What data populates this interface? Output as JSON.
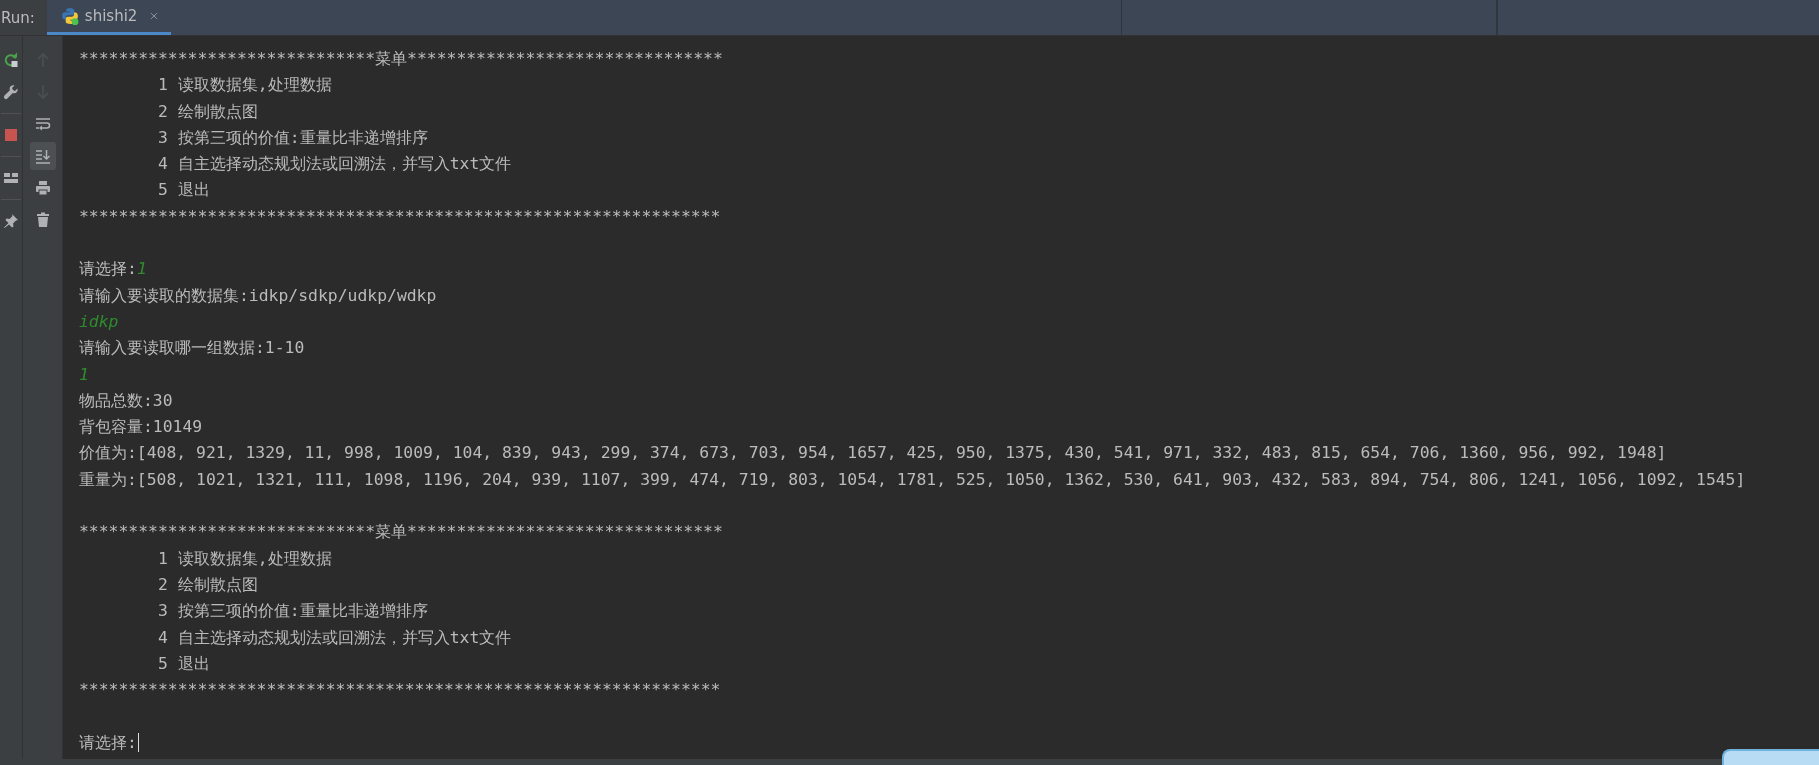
{
  "run_bar": {
    "label": "Run:",
    "tabs": [
      {
        "label": "shishi2",
        "selected": true,
        "closable": true
      }
    ]
  },
  "left_toolbar": [
    {
      "kind": "rerun",
      "disabled": false
    },
    {
      "kind": "wrench",
      "disabled": false
    },
    {
      "kind": "stop",
      "disabled": false
    },
    {
      "kind": "layout",
      "disabled": false
    },
    {
      "kind": "pin",
      "disabled": false
    }
  ],
  "console_toolbar": [
    {
      "kind": "up",
      "disabled": true,
      "selected": false
    },
    {
      "kind": "down",
      "disabled": true,
      "selected": false
    },
    {
      "kind": "wrap",
      "disabled": false,
      "selected": false
    },
    {
      "kind": "scroll-end",
      "disabled": false,
      "selected": true
    },
    {
      "kind": "print",
      "disabled": false,
      "selected": false
    },
    {
      "kind": "trash",
      "disabled": false,
      "selected": false
    }
  ],
  "console_lines": [
    {
      "kind": "text",
      "segments": [
        {
          "kind": "output",
          "text": "******************************菜单********************************"
        }
      ]
    },
    {
      "kind": "menu",
      "segments": [
        {
          "kind": "output",
          "text": "1 读取数据集,处理数据"
        }
      ]
    },
    {
      "kind": "menu",
      "segments": [
        {
          "kind": "output",
          "text": "2 绘制散点图"
        }
      ]
    },
    {
      "kind": "menu",
      "segments": [
        {
          "kind": "output",
          "text": "3 按第三项的价值:重量比非递增排序"
        }
      ]
    },
    {
      "kind": "menu",
      "segments": [
        {
          "kind": "output",
          "text": "4 自主选择动态规划法或回溯法，并写入txt文件"
        }
      ]
    },
    {
      "kind": "menu",
      "segments": [
        {
          "kind": "output",
          "text": "5 退出"
        }
      ]
    },
    {
      "kind": "text",
      "segments": [
        {
          "kind": "output",
          "text": "*****************************************************************"
        }
      ]
    },
    {
      "kind": "blank"
    },
    {
      "kind": "text",
      "segments": [
        {
          "kind": "output",
          "text": "请选择:"
        },
        {
          "kind": "input",
          "text": "1"
        }
      ]
    },
    {
      "kind": "text",
      "segments": [
        {
          "kind": "output",
          "text": "请输入要读取的数据集:idkp/sdkp/udkp/wdkp"
        }
      ]
    },
    {
      "kind": "text",
      "segments": [
        {
          "kind": "input",
          "text": "idkp"
        }
      ]
    },
    {
      "kind": "text",
      "segments": [
        {
          "kind": "output",
          "text": "请输入要读取哪一组数据:1-10"
        }
      ]
    },
    {
      "kind": "text",
      "segments": [
        {
          "kind": "input",
          "text": "1"
        }
      ]
    },
    {
      "kind": "text",
      "segments": [
        {
          "kind": "output",
          "text": "物品总数:30"
        }
      ]
    },
    {
      "kind": "text",
      "segments": [
        {
          "kind": "output",
          "text": "背包容量:10149"
        }
      ]
    },
    {
      "kind": "text",
      "segments": [
        {
          "kind": "output",
          "text": "价值为:[408, 921, 1329, 11, 998, 1009, 104, 839, 943, 299, 374, 673, 703, 954, 1657, 425, 950, 1375, 430, 541, 971, 332, 483, 815, 654, 706, 1360, 956, 992, 1948]"
        }
      ]
    },
    {
      "kind": "text",
      "segments": [
        {
          "kind": "output",
          "text": "重量为:[508, 1021, 1321, 111, 1098, 1196, 204, 939, 1107, 399, 474, 719, 803, 1054, 1781, 525, 1050, 1362, 530, 641, 903, 432, 583, 894, 754, 806, 1241, 1056, 1092, 1545]"
        }
      ]
    },
    {
      "kind": "blank"
    },
    {
      "kind": "text",
      "segments": [
        {
          "kind": "output",
          "text": "******************************菜单********************************"
        }
      ]
    },
    {
      "kind": "menu",
      "segments": [
        {
          "kind": "output",
          "text": "1 读取数据集,处理数据"
        }
      ]
    },
    {
      "kind": "menu",
      "segments": [
        {
          "kind": "output",
          "text": "2 绘制散点图"
        }
      ]
    },
    {
      "kind": "menu",
      "segments": [
        {
          "kind": "output",
          "text": "3 按第三项的价值:重量比非递增排序"
        }
      ]
    },
    {
      "kind": "menu",
      "segments": [
        {
          "kind": "output",
          "text": "4 自主选择动态规划法或回溯法，并写入txt文件"
        }
      ]
    },
    {
      "kind": "menu",
      "segments": [
        {
          "kind": "output",
          "text": "5 退出"
        }
      ]
    },
    {
      "kind": "text",
      "segments": [
        {
          "kind": "output",
          "text": "*****************************************************************"
        }
      ]
    },
    {
      "kind": "blank"
    },
    {
      "kind": "text",
      "cursor": true,
      "segments": [
        {
          "kind": "output",
          "text": "请选择:"
        }
      ]
    }
  ]
}
